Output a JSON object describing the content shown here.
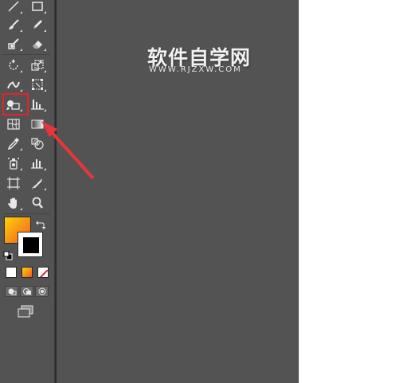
{
  "watermark": {
    "title": "软件自学网",
    "url": "WWW.RJZXW.COM"
  },
  "colors": {
    "panel": "#535353",
    "canvas": "#535353",
    "artboard": "#ffffff",
    "highlight": "#e0252b",
    "arrow": "#e8353b",
    "fill_gradient_start": "#ffd200",
    "fill_gradient_end": "#f05a28",
    "stroke": "#000000"
  },
  "tools": [
    {
      "name": "line-segment-tool",
      "icon": "line-icon"
    },
    {
      "name": "rectangle-tool",
      "icon": "rectangle-icon"
    },
    {
      "name": "paintbrush-tool",
      "icon": "brush-icon"
    },
    {
      "name": "pencil-tool",
      "icon": "pencil-icon"
    },
    {
      "name": "blob-brush-tool",
      "icon": "blob-brush-icon"
    },
    {
      "name": "eraser-tool",
      "icon": "eraser-icon"
    },
    {
      "name": "rotate-tool",
      "icon": "rotate-icon"
    },
    {
      "name": "scale-tool",
      "icon": "scale-icon"
    },
    {
      "name": "width-tool",
      "icon": "width-icon"
    },
    {
      "name": "free-transform-tool",
      "icon": "free-transform-icon"
    },
    {
      "name": "shape-builder-tool",
      "icon": "shape-builder-icon"
    },
    {
      "name": "graph-tool",
      "icon": "graph-icon"
    },
    {
      "name": "mesh-tool",
      "icon": "mesh-icon"
    },
    {
      "name": "gradient-tool",
      "icon": "gradient-icon"
    },
    {
      "name": "eyedropper-tool",
      "icon": "eyedropper-icon"
    },
    {
      "name": "blend-tool",
      "icon": "blend-icon"
    },
    {
      "name": "symbol-sprayer-tool",
      "icon": "symbol-sprayer-icon"
    },
    {
      "name": "column-graph-tool",
      "icon": "column-graph-icon"
    },
    {
      "name": "artboard-tool",
      "icon": "artboard-icon"
    },
    {
      "name": "slice-tool",
      "icon": "slice-icon"
    },
    {
      "name": "hand-tool",
      "icon": "hand-icon"
    },
    {
      "name": "zoom-tool",
      "icon": "zoom-icon"
    }
  ],
  "fill_stroke": {
    "active_fill": "gradient",
    "stroke": "black"
  },
  "color_modes": [
    "color",
    "gradient",
    "none"
  ],
  "draw_modes": [
    "draw-normal",
    "draw-behind",
    "draw-inside"
  ]
}
